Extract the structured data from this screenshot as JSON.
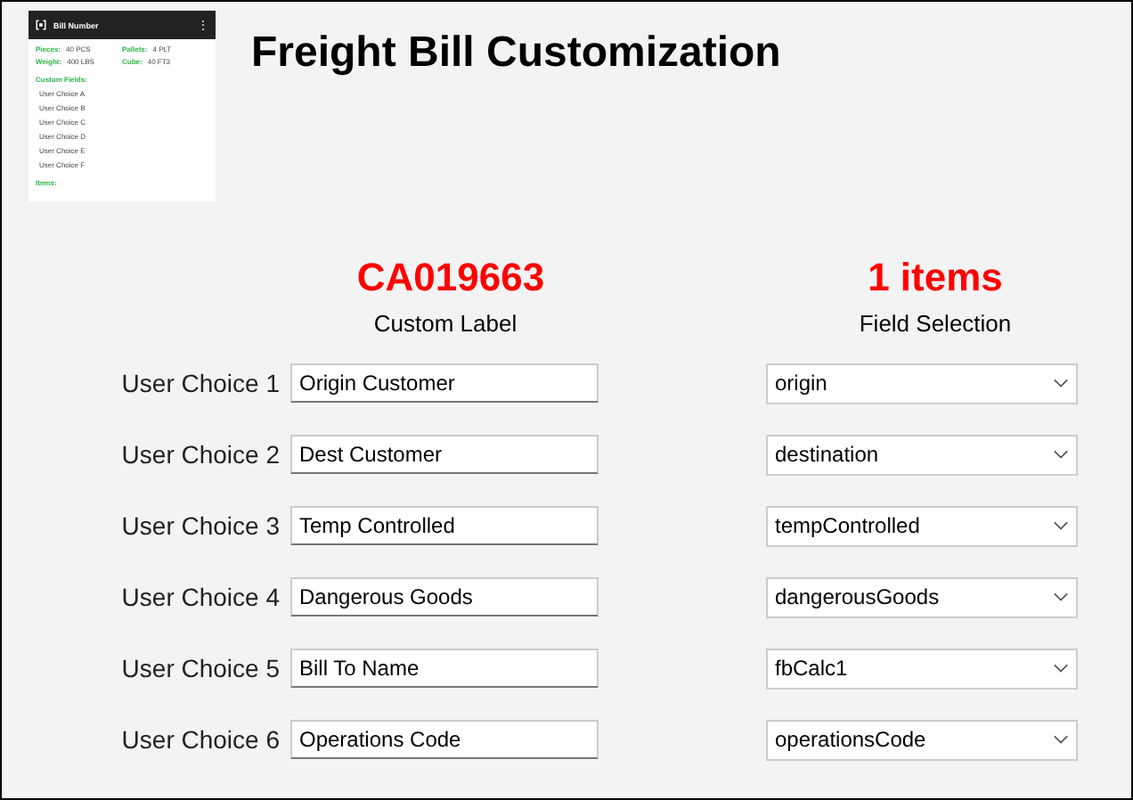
{
  "preview": {
    "title": "Bill Number",
    "menu": "⋮",
    "stats": [
      {
        "label": "Pieces:",
        "value": "40 PCS"
      },
      {
        "label": "Pallets:",
        "value": "4 PLT"
      },
      {
        "label": "Weight:",
        "value": "400 LBS"
      },
      {
        "label": "Cube:",
        "value": "40 FT3"
      }
    ],
    "custom_heading": "Custom Fields:",
    "custom_items": [
      "User Choice A",
      "User Choice B",
      "User Choice C",
      "User Choice D",
      "User Choice E",
      "User Choice F"
    ],
    "items_heading": "Items:"
  },
  "title": "Freight Bill Customization",
  "bill_number": "CA019663",
  "item_count": "1 items",
  "label_heading": "Custom Label",
  "field_heading": "Field Selection",
  "rows": [
    {
      "name": "User Choice 1",
      "label": "Origin Customer",
      "field": "origin"
    },
    {
      "name": "User Choice 2",
      "label": "Dest Customer",
      "field": "destination"
    },
    {
      "name": "User Choice 3",
      "label": "Temp Controlled",
      "field": "tempControlled"
    },
    {
      "name": "User Choice 4",
      "label": "Dangerous Goods",
      "field": "dangerousGoods"
    },
    {
      "name": "User Choice 5",
      "label": "Bill To Name",
      "field": "fbCalc1"
    },
    {
      "name": "User Choice 6",
      "label": "Operations Code",
      "field": "operationsCode"
    }
  ]
}
